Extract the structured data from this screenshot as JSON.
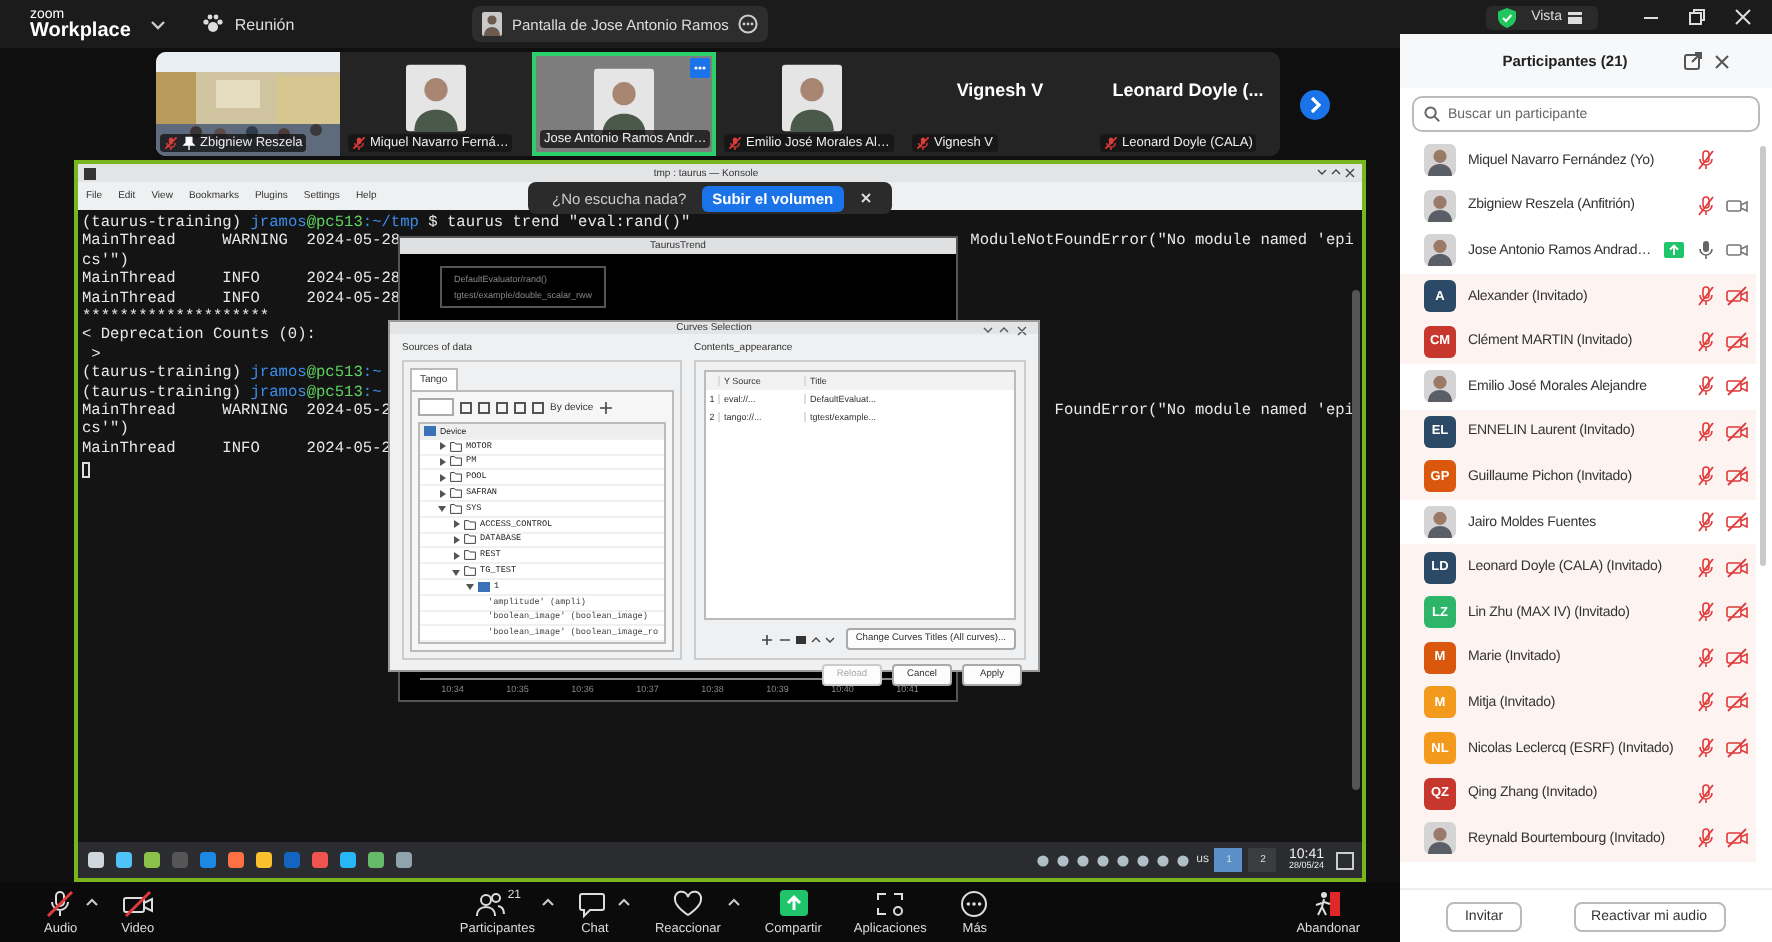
{
  "topbar": {
    "brand_top": "zoom",
    "brand": "Workplace",
    "meeting": "Reunión",
    "share_pill": "Pantalla de Jose Antonio Ramos",
    "view": "Vista"
  },
  "video_tiles": [
    {
      "name": "Zbigniew Reszela",
      "kind": "picture",
      "mic_muted": true,
      "pinned": true,
      "selected": false
    },
    {
      "name": "Miquel Navarro Ferná…",
      "kind": "camera",
      "mic_muted": true,
      "pinned": false,
      "selected": false
    },
    {
      "name": "Jose Antonio Ramos Andr…",
      "kind": "camera",
      "mic_muted": false,
      "pinned": false,
      "selected": true
    },
    {
      "name": "Emilio José Morales Al…",
      "kind": "camera",
      "mic_muted": true,
      "pinned": false,
      "selected": false
    },
    {
      "name": "Vignesh V",
      "kind": "name",
      "title": "Vignesh V",
      "mic_muted": true,
      "pinned": false,
      "selected": false
    },
    {
      "name": "Leonard Doyle (CALA)",
      "kind": "name",
      "title": "Leonard Doyle (...",
      "mic_muted": true,
      "pinned": false,
      "selected": false
    }
  ],
  "shared_screen": {
    "konsole": {
      "title": "tmp : taurus — Konsole",
      "menu": [
        "File",
        "Edit",
        "View",
        "Bookmarks",
        "Plugins",
        "Settings",
        "Help"
      ],
      "lines": [
        {
          "segments": [
            {
              "text": "(taurus-training) ",
              "color": "#e8e8e8"
            },
            {
              "text": "jramos",
              "color": "#3b8eea"
            },
            {
              "text": "@pc513",
              "color": "#5fd35f"
            },
            {
              "text": ":~/tmp",
              "color": "#3b8eea"
            },
            {
              "text": " $ taurus trend \"eval:rand()\"",
              "color": "#e8e8e8"
            }
          ]
        },
        {
          "segments": [
            {
              "text": "MainThread     WARNING  2024-05-28",
              "color": "#e8e8e8"
            }
          ],
          "right": "ModuleNotFoundError(\"No module named 'epi"
        },
        {
          "segments": [
            {
              "text": "cs'\")",
              "color": "#e8e8e8"
            }
          ]
        },
        {
          "segments": [
            {
              "text": "MainThread     INFO     2024-05-28",
              "color": "#e8e8e8"
            }
          ]
        },
        {
          "segments": [
            {
              "text": "MainThread     INFO     2024-05-28",
              "color": "#e8e8e8"
            }
          ]
        },
        {
          "segments": [
            {
              "text": "********************",
              "color": "#e8e8e8"
            }
          ]
        },
        {
          "segments": [
            {
              "text": "< Deprecation Counts (0):",
              "color": "#e8e8e8"
            }
          ]
        },
        {
          "segments": [
            {
              "text": " >",
              "color": "#e8e8e8"
            }
          ]
        },
        {
          "segments": [
            {
              "text": "(taurus-training) ",
              "color": "#e8e8e8"
            },
            {
              "text": "jramos",
              "color": "#3b8eea"
            },
            {
              "text": "@pc513",
              "color": "#5fd35f"
            },
            {
              "text": ":~",
              "color": "#3b8eea"
            }
          ]
        },
        {
          "segments": [
            {
              "text": "(taurus-training) ",
              "color": "#e8e8e8"
            },
            {
              "text": "jramos",
              "color": "#3b8eea"
            },
            {
              "text": "@pc513",
              "color": "#5fd35f"
            },
            {
              "text": ":~",
              "color": "#3b8eea"
            }
          ]
        },
        {
          "segments": [
            {
              "text": "MainThread     WARNING  2024-05-2",
              "color": "#e8e8e8"
            }
          ],
          "right": "FoundError(\"No module named 'epi"
        },
        {
          "segments": [
            {
              "text": "cs'\")",
              "color": "#e8e8e8"
            }
          ]
        },
        {
          "segments": [
            {
              "text": "MainThread     INFO     2024-05-2",
              "color": "#e8e8e8"
            }
          ]
        }
      ]
    },
    "toast": {
      "text": "¿No escucha nada?",
      "button": "Subir el volumen"
    },
    "trend": {
      "title": "TaurusTrend",
      "legend": [
        "DefaultEvaluator/rand()",
        "tgtest/example/double_scalar_rww"
      ],
      "ticks": [
        "10:34",
        "10:35",
        "10:36",
        "10:37",
        "10:38",
        "10:39",
        "10:40",
        "10:41"
      ]
    },
    "curves": {
      "title": "Curves Selection",
      "sources_label": "Sources of data",
      "tab": "Tango",
      "view_mode": "By device",
      "contents_label": "Contents_appearance",
      "tree": [
        {
          "label": "Device",
          "kind": "root",
          "children": [
            {
              "label": "MOTOR",
              "kind": "folder",
              "expanded": false
            },
            {
              "label": "PM",
              "kind": "folder",
              "expanded": false
            },
            {
              "label": "POOL",
              "kind": "folder",
              "expanded": false
            },
            {
              "label": "SAFRAN",
              "kind": "folder",
              "expanded": false
            },
            {
              "label": "SYS",
              "kind": "folder",
              "expanded": true,
              "children": [
                {
                  "label": "ACCESS_CONTROL",
                  "kind": "folder",
                  "expanded": false
                },
                {
                  "label": "DATABASE",
                  "kind": "folder",
                  "expanded": false
                },
                {
                  "label": "REST",
                  "kind": "folder",
                  "expanded": false
                },
                {
                  "label": "TG_TEST",
                  "kind": "folder",
                  "expanded": true,
                  "children": [
                    {
                      "label": "1",
                      "kind": "device",
                      "expanded": true,
                      "children": [
                        {
                          "label": "'amplitude' (ampli)",
                          "kind": "attribute"
                        },
                        {
                          "label": "'boolean_image' (boolean_image)",
                          "kind": "attribute"
                        },
                        {
                          "label": "'boolean_image' (boolean_image_ro",
                          "kind": "attribute"
                        }
                      ]
                    }
                  ]
                }
              ]
            }
          ]
        }
      ],
      "columns": [
        "Y Source",
        "Title"
      ],
      "rows": [
        {
          "index": "1",
          "source": "eval://...",
          "title": "DefaultEvaluat..."
        },
        {
          "index": "2",
          "source": "tango://...",
          "title": "tgtest/example..."
        }
      ],
      "change_titles": "Change Curves Titles (All curves)...",
      "buttons": [
        {
          "label": "Reload",
          "disabled": true
        },
        {
          "label": "Cancel",
          "disabled": false
        },
        {
          "label": "Apply",
          "disabled": false
        }
      ]
    },
    "taskbar": {
      "keyboard": "us",
      "pager": [
        {
          "label": "1",
          "selected": true
        },
        {
          "label": "2",
          "selected": false
        }
      ],
      "time": "10:41",
      "date": "28/05/24"
    }
  },
  "toolbar": [
    {
      "label": "Audio",
      "kind": "audio",
      "off": true,
      "caret": true
    },
    {
      "label": "Video",
      "kind": "video",
      "off": true,
      "caret": false
    },
    {
      "label": "Participantes",
      "kind": "participants",
      "badge": "21",
      "caret": true
    },
    {
      "label": "Chat",
      "kind": "chat",
      "caret": true
    },
    {
      "label": "Reaccionar",
      "kind": "react",
      "caret": true
    },
    {
      "label": "Compartir",
      "kind": "share",
      "caret": false
    },
    {
      "label": "Aplicaciones",
      "kind": "apps",
      "caret": false
    },
    {
      "label": "Más",
      "kind": "more",
      "caret": false
    },
    {
      "label": "Abandonar",
      "kind": "leave",
      "caret": false
    }
  ],
  "participants": {
    "title": "Participantes (21)",
    "placeholder": "Buscar un participante",
    "rows": [
      {
        "name": "Miquel Navarro Fernández (Yo)",
        "mic_muted": true,
        "highlighted": false,
        "sharing": false
      },
      {
        "name": "Zbigniew Reszela (Anfitrión)",
        "mic_muted": true,
        "video_muted": false,
        "highlighted": false,
        "sharing": false
      },
      {
        "name": "Jose Antonio Ramos Andrad…",
        "mic_muted": false,
        "video_muted": false,
        "highlighted": false,
        "sharing": true
      },
      {
        "name": "Alexander (Invitado)",
        "kind": "initials",
        "initials": "A",
        "color": "#2c4a68",
        "mic_muted": true,
        "video_muted": true,
        "highlighted": true,
        "sharing": false
      },
      {
        "name": "Clément MARTIN (Invitado)",
        "kind": "initials",
        "initials": "CM",
        "color": "#c8372d",
        "mic_muted": true,
        "video_muted": true,
        "highlighted": true,
        "sharing": false
      },
      {
        "name": "Emilio José Morales Alejandre",
        "mic_muted": true,
        "video_muted": true,
        "highlighted": false,
        "sharing": false
      },
      {
        "name": "ENNELIN Laurent (Invitado)",
        "kind": "initials",
        "initials": "EL",
        "color": "#2c4a68",
        "mic_muted": true,
        "video_muted": true,
        "highlighted": true,
        "sharing": false
      },
      {
        "name": "Guillaume Pichon (Invitado)",
        "kind": "initials",
        "initials": "GP",
        "color": "#d9580d",
        "mic_muted": true,
        "video_muted": true,
        "highlighted": true,
        "sharing": false
      },
      {
        "name": "Jairo Moldes Fuentes",
        "mic_muted": true,
        "video_muted": true,
        "highlighted": false,
        "sharing": false
      },
      {
        "name": "Leonard Doyle (CALA) (Invitado)",
        "kind": "initials",
        "initials": "LD",
        "color": "#2c4a68",
        "mic_muted": true,
        "video_muted": true,
        "highlighted": true,
        "sharing": false
      },
      {
        "name": "Lin Zhu (MAX IV) (Invitado)",
        "kind": "initials",
        "initials": "LZ",
        "color": "#2fb56a",
        "mic_muted": true,
        "video_muted": true,
        "highlighted": true,
        "sharing": false
      },
      {
        "name": "Marie (Invitado)",
        "kind": "initials",
        "initials": "M",
        "color": "#d9580d",
        "mic_muted": true,
        "video_muted": true,
        "highlighted": true,
        "sharing": false
      },
      {
        "name": "Mitja (Invitado)",
        "kind": "initials",
        "initials": "M",
        "color": "#f39a1c",
        "mic_muted": true,
        "video_muted": true,
        "highlighted": true,
        "sharing": false
      },
      {
        "name": "Nicolas Leclercq (ESRF) (Invitado)",
        "kind": "initials",
        "initials": "NL",
        "color": "#f39a1c",
        "mic_muted": true,
        "video_muted": true,
        "highlighted": true,
        "sharing": false
      },
      {
        "name": "Qing Zhang (Invitado)",
        "kind": "initials",
        "initials": "QZ",
        "color": "#c8372d",
        "mic_muted": true,
        "highlighted": true,
        "sharing": false
      },
      {
        "name": "Reynald Bourtembourg (Invitado)",
        "mic_muted": true,
        "video_muted": true,
        "highlighted": true,
        "sharing": false
      }
    ],
    "buttons": [
      "Invitar",
      "Reactivar mi audio"
    ]
  }
}
